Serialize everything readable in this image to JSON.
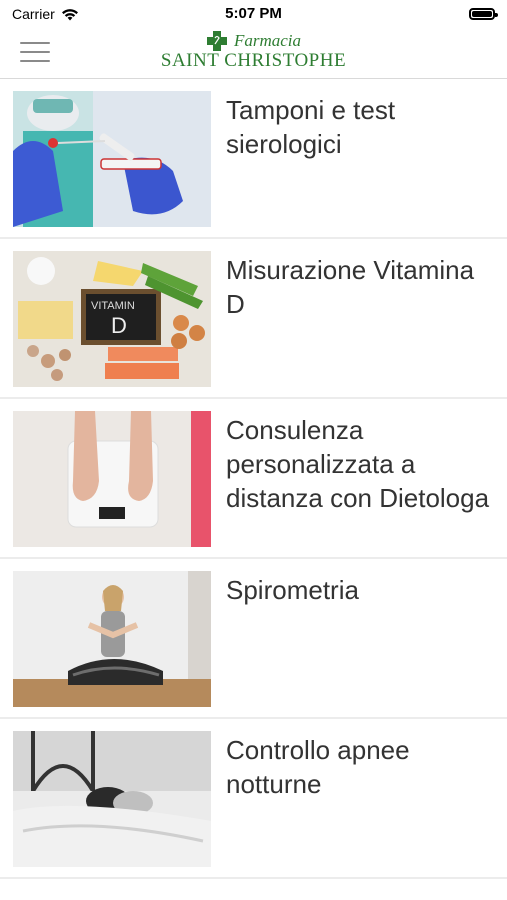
{
  "status": {
    "carrier": "Carrier",
    "time": "5:07 PM"
  },
  "header": {
    "logo_small": "Farmacia",
    "logo_big": "SAINT CHRISTOPHE",
    "brand_color": "#2e7d32"
  },
  "items": [
    {
      "title": "Tamponi e test sierologici",
      "image": "covid-test-photo"
    },
    {
      "title": "Misurazione Vitamina D",
      "image": "vitamin-d-food-photo"
    },
    {
      "title": "Consulenza personalizzata a distanza con Dietologa",
      "image": "scale-feet-photo"
    },
    {
      "title": "Spirometria",
      "image": "breathing-woman-photo"
    },
    {
      "title": "Controllo apnee notturne",
      "image": "sleeping-person-photo"
    }
  ]
}
